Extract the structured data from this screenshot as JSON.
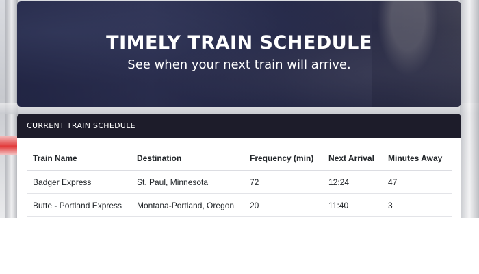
{
  "hero": {
    "title": "TIMELY TRAIN SCHEDULE",
    "subtitle": "See when your next train will arrive."
  },
  "schedule": {
    "header": "CURRENT TRAIN SCHEDULE",
    "columns": [
      "Train Name",
      "Destination",
      "Frequency (min)",
      "Next Arrival",
      "Minutes Away"
    ],
    "rows": [
      [
        "Badger Express",
        "St. Paul, Minnesota",
        "72",
        "12:24",
        "47"
      ],
      [
        "Butte - Portland Express",
        "Montana-Portland, Oregon",
        "20",
        "11:40",
        "3"
      ]
    ]
  },
  "colors": {
    "card_header_bg": "#1d1c2a",
    "hero_bg": "#2e3254"
  }
}
